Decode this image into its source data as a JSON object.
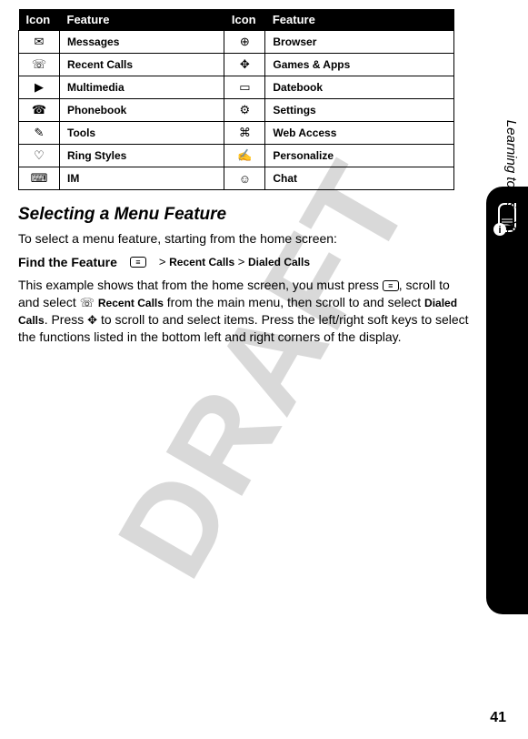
{
  "watermark": "DRAFT",
  "table": {
    "headers": [
      "Icon",
      "Feature",
      "Icon",
      "Feature"
    ],
    "rows": [
      {
        "icon1": "envelope-icon",
        "sym1": "✉",
        "feat1": "Messages",
        "icon2": "globe-icon",
        "sym2": "⊕",
        "feat2": "Browser"
      },
      {
        "icon1": "recent-calls-icon",
        "sym1": "☏",
        "feat1": "Recent Calls",
        "icon2": "joystick-icon",
        "sym2": "✥",
        "feat2": "Games & Apps"
      },
      {
        "icon1": "multimedia-icon",
        "sym1": "▶",
        "feat1": "Multimedia",
        "icon2": "datebook-icon",
        "sym2": "▭",
        "feat2": "Datebook"
      },
      {
        "icon1": "phonebook-icon",
        "sym1": "☎",
        "feat1": "Phonebook",
        "icon2": "settings-icon",
        "sym2": "⚙",
        "feat2": "Settings"
      },
      {
        "icon1": "tools-icon",
        "sym1": "✎",
        "feat1": "Tools",
        "icon2": "web-access-icon",
        "sym2": "⌘",
        "feat2": "Web Access"
      },
      {
        "icon1": "ring-styles-icon",
        "sym1": "♡",
        "feat1": "Ring Styles",
        "icon2": "personalize-icon",
        "sym2": "✍",
        "feat2": "Personalize"
      },
      {
        "icon1": "im-icon",
        "sym1": "⌨",
        "feat1": "IM",
        "icon2": "chat-icon",
        "sym2": "☺",
        "feat2": "Chat"
      }
    ]
  },
  "section_heading": "Selecting a Menu Feature",
  "intro_para": "To select a menu feature, starting from the home screen:",
  "find": {
    "label": "Find the Feature",
    "menu_key": "≡",
    "sep": ">",
    "crumb1": "Recent Calls",
    "crumb2": "Dialed Calls"
  },
  "body_parts": {
    "p1": "This example shows that from the home screen, you must press ",
    "p2": ", scroll to and select ",
    "recent_calls": "Recent Calls",
    "p3": " from the main menu, then scroll to and select ",
    "dialed_calls": "Dialed Calls",
    "p4": ". Press ",
    "nav_sym": "✥",
    "p5": " to scroll to and select items. Press the left/right soft keys to select the functions listed in the bottom left and right corners of the display."
  },
  "side_label": "Learning to Use Your Phone",
  "page_number": "41"
}
